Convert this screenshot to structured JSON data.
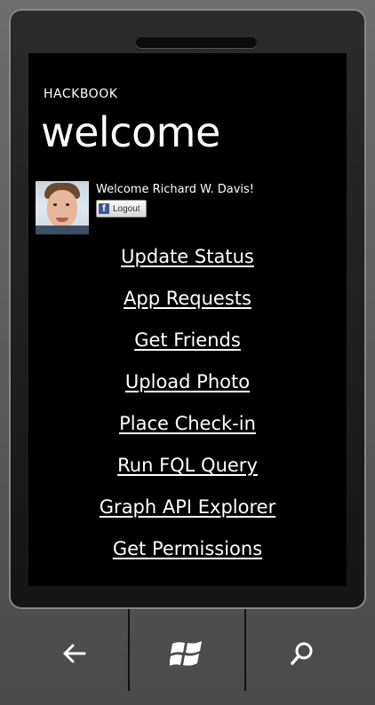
{
  "app": {
    "name": "HACKBOOK",
    "page_title": "welcome"
  },
  "user": {
    "welcome_text": "Welcome Richard W. Davis!",
    "logout_label": "Logout"
  },
  "menu": {
    "items": [
      {
        "label": "Update Status"
      },
      {
        "label": "App Requests"
      },
      {
        "label": "Get Friends"
      },
      {
        "label": "Upload Photo"
      },
      {
        "label": "Place Check-in"
      },
      {
        "label": "Run FQL Query"
      },
      {
        "label": "Graph API Explorer"
      },
      {
        "label": "Get Permissions"
      }
    ]
  },
  "hardware_buttons": {
    "back": "back-arrow-icon",
    "start": "windows-logo-icon",
    "search": "search-icon"
  },
  "colors": {
    "screen_bg": "#000000",
    "text": "#ffffff",
    "facebook_blue": "#3b5998"
  }
}
